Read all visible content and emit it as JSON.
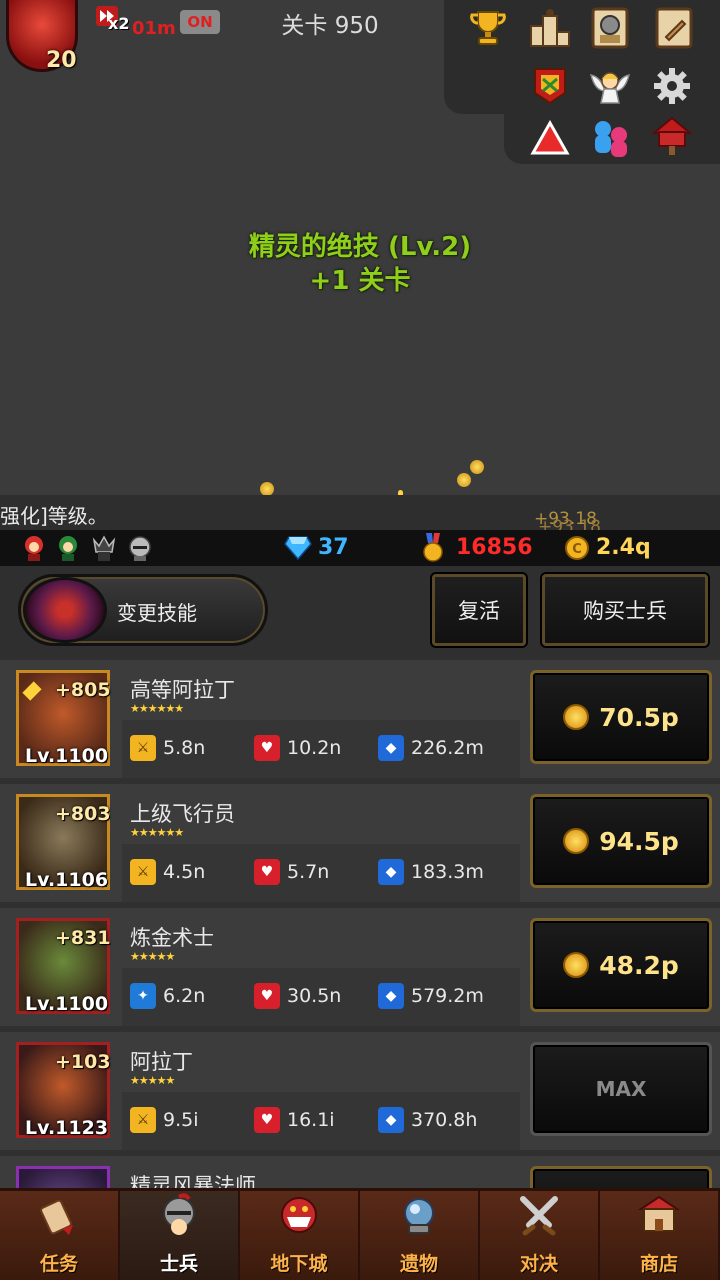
{
  "hud": {
    "player_level": "20",
    "speed_multiplier": "x2",
    "speed_time": "01m",
    "speed_toggle": "ON",
    "stage_title": "关卡 950"
  },
  "top_icons": {
    "row1": [
      "trophy-icon",
      "ranking-podium-icon",
      "knight-portrait-icon",
      "quest-book-icon"
    ],
    "row2": [
      "guild-banner-icon",
      "angel-icon",
      "gear-icon"
    ],
    "row3": [
      "warning-triangle-icon",
      "friends-icon",
      "mailbox-icon"
    ]
  },
  "skill_message": {
    "line1": "精灵的绝技 (Lv.2)",
    "line2": "+1 关卡"
  },
  "ticker": {
    "text": "强化]等级。",
    "floating1": "+93.18",
    "floating2": "+93.18"
  },
  "resources": {
    "gems": "37",
    "medals": "16856",
    "gold": "2.4q",
    "gem_color": "#3fb6ff",
    "medal_color": "#ff2a2a",
    "gold_color": "#ffd65a"
  },
  "controls": {
    "change_skill": "变更技能",
    "revive": "复活",
    "buy_soldier": "购买士兵"
  },
  "soldiers": [
    {
      "name": "高等阿拉丁",
      "plus": "+805",
      "level": "Lv.1100",
      "atk": "5.8n",
      "hp": "10.2n",
      "def": "226.2m",
      "price": "70.5p",
      "atk_type": "sword",
      "frame": "gold"
    },
    {
      "name": "上级飞行员",
      "plus": "+803",
      "level": "Lv.1106",
      "atk": "4.5n",
      "hp": "5.7n",
      "def": "183.3m",
      "price": "94.5p",
      "atk_type": "sword",
      "frame": "gold"
    },
    {
      "name": "炼金术士",
      "plus": "+831",
      "level": "Lv.1100",
      "atk": "6.2n",
      "hp": "30.5n",
      "def": "579.2m",
      "price": "48.2p",
      "atk_type": "magic",
      "frame": "red"
    },
    {
      "name": "阿拉丁",
      "plus": "+103",
      "level": "Lv.1123",
      "atk": "9.5i",
      "hp": "16.1i",
      "def": "370.8h",
      "price": "MAX",
      "atk_type": "sword",
      "frame": "red"
    },
    {
      "name": "精灵风暴法师",
      "plus": "",
      "level": "",
      "atk": "",
      "hp": "",
      "def": "",
      "price": "",
      "atk_type": "magic",
      "frame": "purple"
    }
  ],
  "nav": [
    {
      "label": "任务",
      "icon": "scroll-icon"
    },
    {
      "label": "士兵",
      "icon": "soldier-helmet-icon"
    },
    {
      "label": "地下城",
      "icon": "dungeon-monster-icon"
    },
    {
      "label": "遗物",
      "icon": "relic-orb-icon"
    },
    {
      "label": "对决",
      "icon": "crossed-swords-icon"
    },
    {
      "label": "商店",
      "icon": "shop-icon"
    }
  ]
}
